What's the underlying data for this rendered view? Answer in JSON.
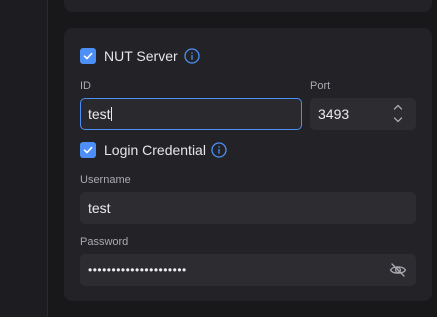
{
  "nut": {
    "checkbox_checked": true,
    "label": "NUT Server"
  },
  "id_field": {
    "label": "ID",
    "value": "test"
  },
  "port_field": {
    "label": "Port",
    "value": "3493"
  },
  "login": {
    "checkbox_checked": true,
    "label": "Login Credential"
  },
  "username_field": {
    "label": "Username",
    "value": "test"
  },
  "password_field": {
    "label": "Password",
    "value": "•••••••••••••••••••••"
  },
  "colors": {
    "accent": "#4c8ff6",
    "card": "#232327",
    "input": "#2c2c31"
  }
}
